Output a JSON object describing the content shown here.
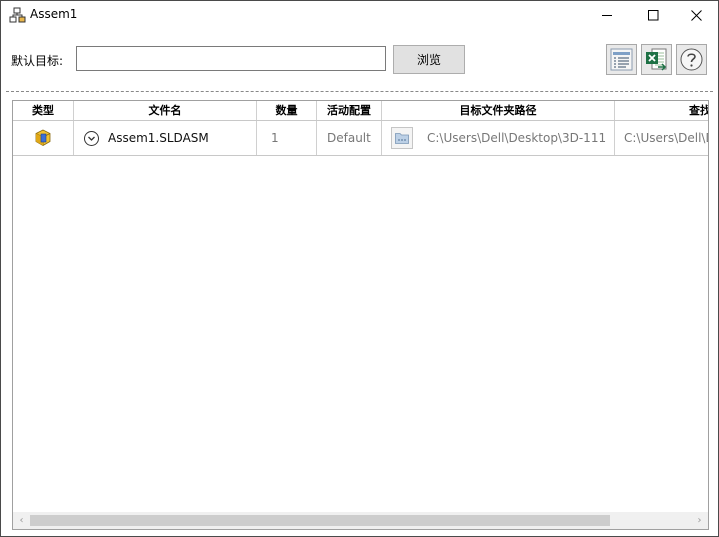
{
  "window": {
    "title": "Assem1",
    "icon": "assembly-icon",
    "controls": [
      "minimize-icon",
      "maximize-icon",
      "close-icon"
    ]
  },
  "toolbar": {
    "default_target_label": "默认目标:",
    "default_target_value": "",
    "browse_label": "浏览",
    "tool_icons": [
      "list-view-icon",
      "excel-export-icon",
      "help-icon"
    ]
  },
  "table": {
    "columns": [
      "类型",
      "文件名",
      "数量",
      "活动配置",
      "目标文件夹路径",
      "查找"
    ],
    "rows": [
      {
        "type_icon": "assembly-part-icon",
        "file_name": "Assem1.SLDASM",
        "quantity": "1",
        "active_config": "Default",
        "target_path": "C:\\Users\\Dell\\Desktop\\3D-111",
        "find_path": "C:\\Users\\Dell\\D"
      }
    ]
  },
  "scrollbar": {
    "position_fraction": 0.0
  }
}
